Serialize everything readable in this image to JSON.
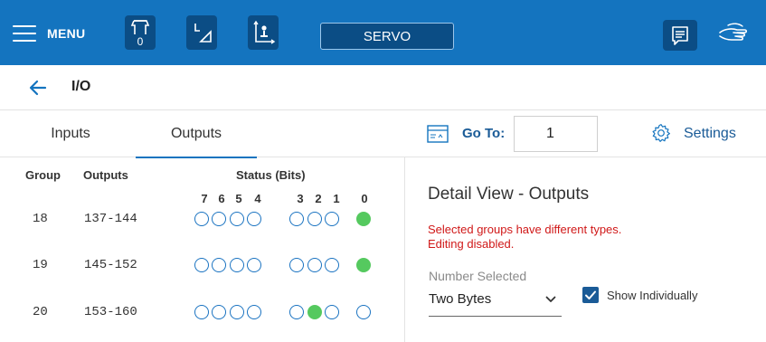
{
  "topbar": {
    "menu_label": "MENU",
    "gripper_count": "0",
    "servo_label": "SERVO",
    "icons": [
      "menu-icon",
      "gripper-icon",
      "jog-mode-icon",
      "coordinate-frame-icon",
      "chat-icon",
      "hand-guide-icon"
    ]
  },
  "page": {
    "title": "I/O"
  },
  "tabs": [
    {
      "label": "Inputs",
      "active": false
    },
    {
      "label": "Outputs",
      "active": true
    }
  ],
  "goto": {
    "label": "Go To:",
    "value": "1"
  },
  "settings": {
    "label": "Settings"
  },
  "table": {
    "headers": {
      "group": "Group",
      "outputs": "Outputs",
      "status": "Status (Bits)"
    },
    "bit_labels": [
      "7",
      "6",
      "5",
      "4",
      "3",
      "2",
      "1",
      "0"
    ],
    "rows": [
      {
        "group": "18",
        "range": "137-144",
        "bits": [
          0,
          0,
          0,
          0,
          0,
          0,
          0,
          1
        ]
      },
      {
        "group": "19",
        "range": "145-152",
        "bits": [
          0,
          0,
          0,
          0,
          0,
          0,
          0,
          1
        ]
      },
      {
        "group": "20",
        "range": "153-160",
        "bits": [
          0,
          0,
          0,
          0,
          0,
          1,
          0,
          0
        ]
      }
    ]
  },
  "detail": {
    "title": "Detail View - Outputs",
    "warning_line1": "Selected groups have different types.",
    "warning_line2": "Editing disabled.",
    "number_selected_label": "Number Selected",
    "number_selected_value": "Two Bytes",
    "show_individually_label": "Show Individually",
    "show_individually_checked": true
  },
  "colors": {
    "topbar": "#1474bf",
    "icon_bg": "#0b4d85",
    "accent": "#1a5b97",
    "bit_on": "#55c95f",
    "bit_off_border": "#1a73c1",
    "warning": "#d01818"
  }
}
